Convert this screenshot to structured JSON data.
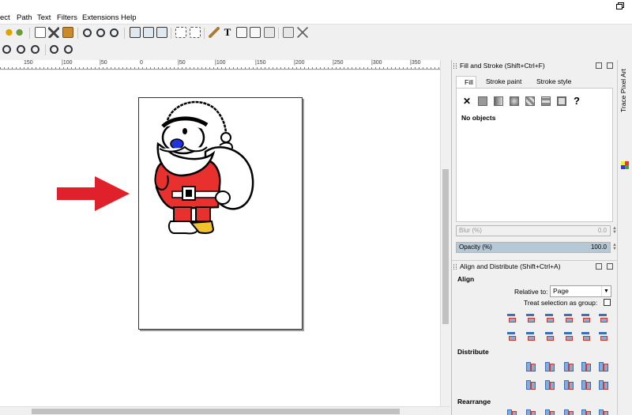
{
  "menu": {
    "items": [
      "ect",
      "Path",
      "Text",
      "Filters",
      "Extensions",
      "Help"
    ]
  },
  "toolbar": {
    "text_tool_glyph": "T",
    "icons": [
      "undo-icon",
      "redo-icon",
      "duplicate-icon",
      "cut-icon",
      "paste-icon",
      "zoom-selection-icon",
      "zoom-drawing-icon",
      "zoom-page-icon",
      "group-icon",
      "ungroup-icon",
      "clone-icon",
      "node-icon",
      "bezier-icon",
      "text-icon",
      "xml-editor-icon",
      "layers-icon",
      "document-properties-icon",
      "preferences-icon"
    ]
  },
  "ruler": {
    "labels": [
      "150",
      "|100",
      "|50",
      "0",
      "|50",
      "|100",
      "|150",
      "|200",
      "|250",
      "|300",
      "|350",
      "|400"
    ]
  },
  "fill_stroke": {
    "title": "Fill and Stroke (Shift+Ctrl+F)",
    "tabs": [
      "Fill",
      "Stroke paint",
      "Stroke style"
    ],
    "no_paint_glyph": "✕",
    "unknown_glyph": "?",
    "status": "No objects",
    "blur_label": "Blur (%)",
    "blur_value": "0.0",
    "opacity_label": "Opacity (%)",
    "opacity_value": "100.0"
  },
  "align": {
    "title": "Align and Distribute (Shift+Ctrl+A)",
    "align_heading": "Align",
    "relative_label": "Relative to:",
    "relative_value": "Page",
    "treat_label": "Treat selection as group:",
    "distribute_heading": "Distribute",
    "rearrange_heading": "Rearrange"
  },
  "side_tab": {
    "label": "Trace Pixel Art"
  },
  "colors": {
    "santa_red": "#e8312f",
    "nose_blue": "#2233dd",
    "boot_yellow": "#f2c12e",
    "arrow_red": "#e0202a",
    "opacity_bar": "#b6c7d6"
  }
}
